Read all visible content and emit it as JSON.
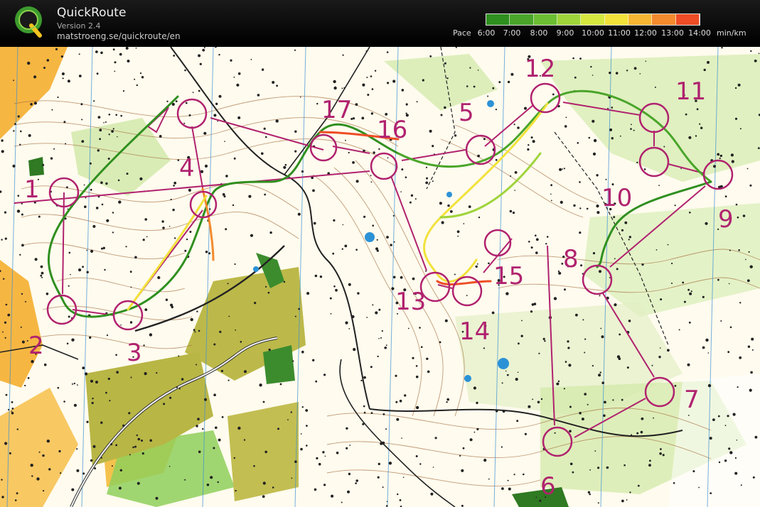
{
  "app": {
    "title": "QuickRoute",
    "version": "Version 2.4",
    "url": "matstroeng.se/quickroute/en"
  },
  "pace_legend": {
    "label": "Pace",
    "ticks": [
      "6:00",
      "7:00",
      "8:00",
      "9:00",
      "10:00",
      "11:00",
      "12:00",
      "13:00",
      "14:00"
    ],
    "unit": "min/km",
    "colors": [
      "#2f8f1f",
      "#4aa52a",
      "#6cbf32",
      "#9fd43a",
      "#d6e83f",
      "#f2e23a",
      "#f7b733",
      "#f38a2e",
      "#ee4d25"
    ]
  },
  "course": {
    "control_numbers": [
      "1",
      "2",
      "3",
      "4",
      "5",
      "6",
      "7",
      "8",
      "9",
      "10",
      "11",
      "12",
      "13",
      "14",
      "15",
      "16",
      "17"
    ],
    "course_color": "#b0226f"
  }
}
